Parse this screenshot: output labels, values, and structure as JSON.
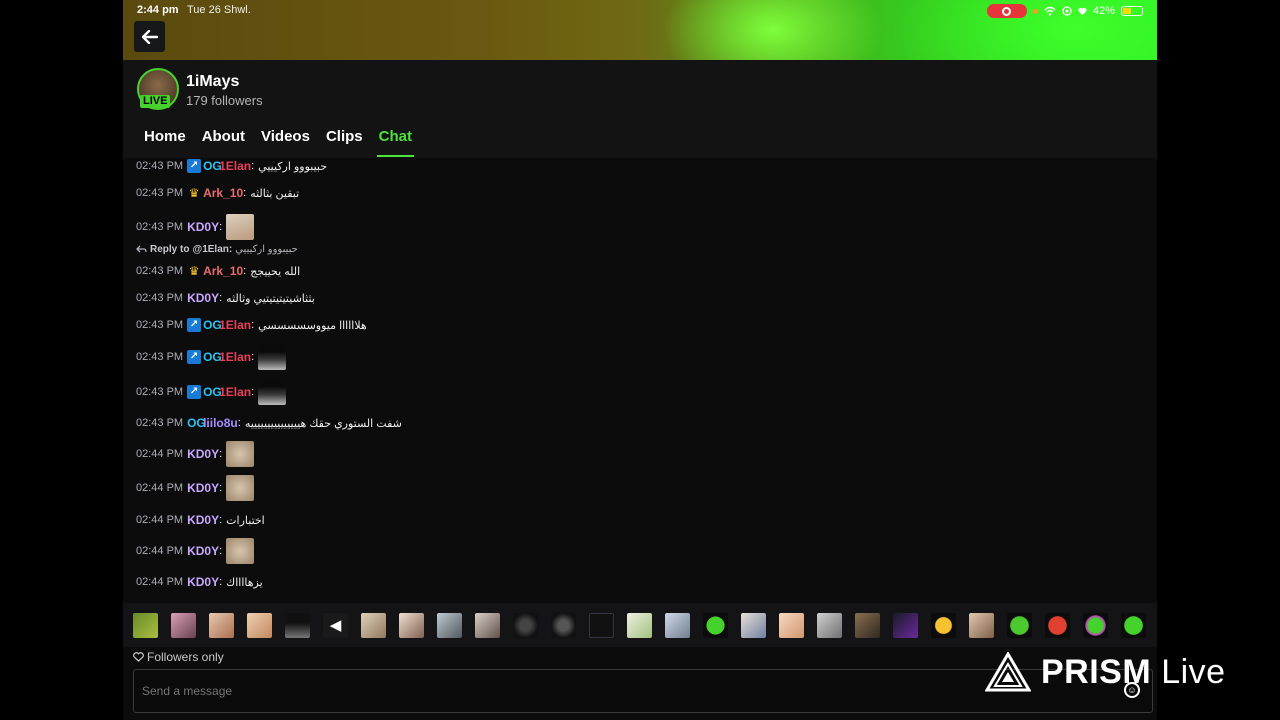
{
  "status": {
    "time": "2:44 pm",
    "date": "Tue 26 Shwl.",
    "battery": "42%"
  },
  "channel": {
    "name": "1iMays",
    "followers": "179 followers",
    "live": "LIVE"
  },
  "tabs": [
    "Home",
    "About",
    "Videos",
    "Clips",
    "Chat"
  ],
  "active_tab": "Chat",
  "reply": {
    "prefix": "Reply to",
    "target": "@1Elan:",
    "quote": "حبيبووو اركيييي"
  },
  "messages": [
    {
      "time": "02:43 PM",
      "user": "1Elan",
      "sep": ":",
      "text": "حبيبووو اركيييي"
    },
    {
      "time": "02:43 PM",
      "user": "Ark_10",
      "sep": ":",
      "text": "تبقين بثالثه"
    },
    {
      "time": "02:43 PM",
      "user": "KD0Y",
      "sep": ":",
      "text": ""
    },
    {
      "time": "02:43 PM",
      "user": "Ark_10",
      "sep": ":",
      "text": "الله يحييجج"
    },
    {
      "time": "02:43 PM",
      "user": "KD0Y",
      "sep": ":",
      "text": "بثثاشيتيتيتيتيي وثالثه"
    },
    {
      "time": "02:43 PM",
      "user": "1Elan",
      "sep": ":",
      "text": "هلاااااا ميووسسسسسي"
    },
    {
      "time": "02:43 PM",
      "user": "1Elan",
      "sep": ":",
      "text": ""
    },
    {
      "time": "02:43 PM",
      "user": "1Elan",
      "sep": ":",
      "text": ""
    },
    {
      "time": "02:43 PM",
      "user": "liilo8u",
      "sep": ":",
      "text": "شفت الستوري حقك هيييييييييييييييه"
    },
    {
      "time": "02:44 PM",
      "user": "KD0Y",
      "sep": ":",
      "text": ""
    },
    {
      "time": "02:44 PM",
      "user": "KD0Y",
      "sep": ":",
      "text": ""
    },
    {
      "time": "02:44 PM",
      "user": "KD0Y",
      "sep": ":",
      "text": "اختبارات"
    },
    {
      "time": "02:44 PM",
      "user": "KD0Y",
      "sep": ":",
      "text": ""
    },
    {
      "time": "02:44 PM",
      "user": "KD0Y",
      "sep": ":",
      "text": "يزهااااك"
    }
  ],
  "colors": {
    "accent": "#4de23a",
    "elan": "#e84058",
    "ark": "#e86a6a",
    "kd0y": "#c8a8ff",
    "liilo": "#a98cff"
  },
  "followers_only": "Followers only",
  "input_placeholder": "Send a message",
  "watermark": {
    "brand": "PRISM",
    "suffix": "Live"
  }
}
